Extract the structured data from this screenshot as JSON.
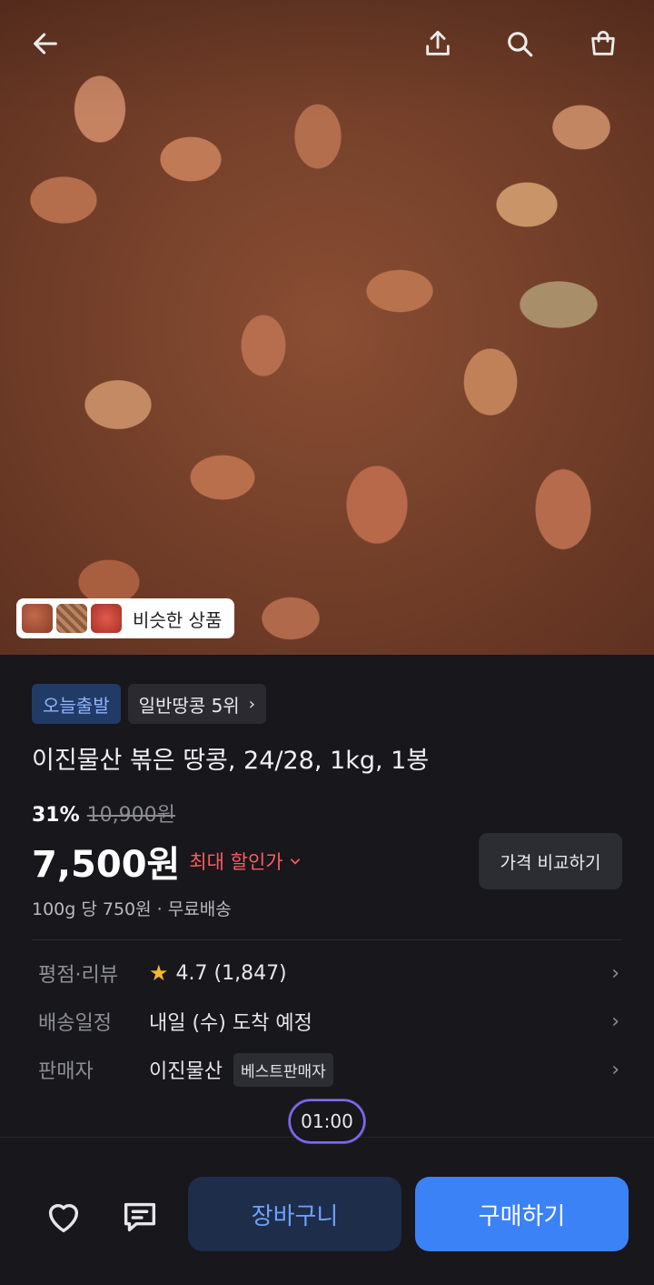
{
  "header": {
    "back_icon": "arrow-left-icon",
    "share_icon": "share-icon",
    "search_icon": "search-icon",
    "cart_icon": "shopping-bag-icon"
  },
  "similar": {
    "label": "비슷한 상품"
  },
  "badges": {
    "today_ship": "오늘출발",
    "ranking": "일반땅콩 5위"
  },
  "product": {
    "title": "이진물산 볶은 땅콩, 24/28, 1kg, 1봉",
    "discount_pct": "31%",
    "original_price": "10,900원",
    "price": "7,500원",
    "max_discount": "최대 할인가",
    "compare_label": "가격 비교하기",
    "unit_price": "100g 당 750원 · 무료배송"
  },
  "info": {
    "rating_key": "평점·리뷰",
    "rating_val": "4.7 (1,847)",
    "delivery_key": "배송일정",
    "delivery_val": "내일 (수) 도착 예정",
    "seller_key": "판매자",
    "seller_val": "이진물산",
    "seller_tag": "베스트판매자"
  },
  "timer": "01:00",
  "bottom": {
    "cart_label": "장바구니",
    "buy_label": "구매하기"
  },
  "colors": {
    "accent": "#3b82f6",
    "discount": "#ff5a5f",
    "star": "#f5b82e"
  }
}
